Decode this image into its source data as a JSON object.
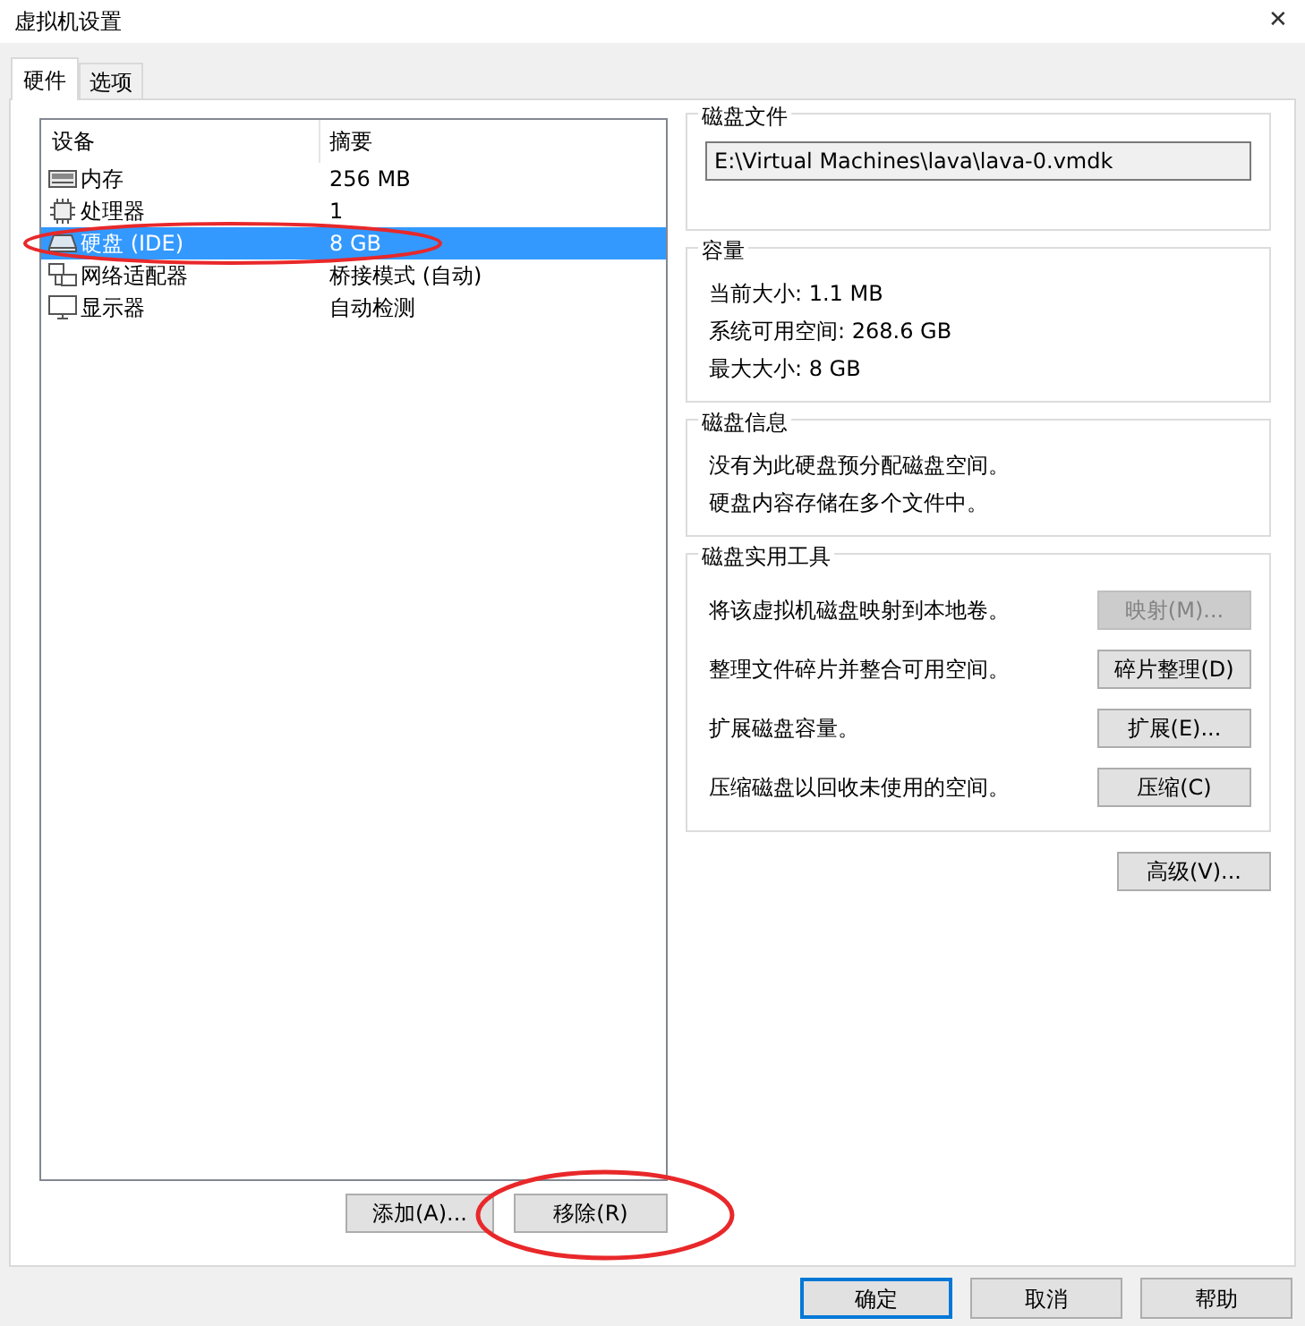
{
  "window": {
    "title": "虚拟机设置",
    "close": "✕"
  },
  "tabs": [
    {
      "label": "硬件",
      "selected": true
    },
    {
      "label": "选项",
      "selected": false
    }
  ],
  "devices": {
    "columns": [
      "设备",
      "摘要"
    ],
    "rows": [
      {
        "kind": "memory",
        "name": "内存",
        "summary": "256 MB",
        "selected": false
      },
      {
        "kind": "cpu",
        "name": "处理器",
        "summary": "1",
        "selected": false
      },
      {
        "kind": "disk",
        "name": "硬盘 (IDE)",
        "summary": "8 GB",
        "selected": true
      },
      {
        "kind": "network",
        "name": "网络适配器",
        "summary": "桥接模式 (自动)",
        "selected": false
      },
      {
        "kind": "display",
        "name": "显示器",
        "summary": "自动检测",
        "selected": false
      }
    ],
    "buttons": [
      {
        "label": "添加(A)..."
      },
      {
        "label": "移除(R)"
      }
    ]
  },
  "disk_file": {
    "title": "磁盘文件",
    "value": "E:\\Virtual Machines\\lava\\lava-0.vmdk"
  },
  "capacity": {
    "title": "容量",
    "lines": [
      "当前大小: 1.1 MB",
      "系统可用空间: 268.6 GB",
      "最大大小: 8 GB"
    ]
  },
  "disk_info": {
    "title": "磁盘信息",
    "lines": [
      "没有为此硬盘预分配磁盘空间。",
      "硬盘内容存储在多个文件中。"
    ]
  },
  "utilities": {
    "title": "磁盘实用工具",
    "rows": [
      {
        "text": "将该虚拟机磁盘映射到本地卷。",
        "button": "映射(M)...",
        "disabled": true
      },
      {
        "text": "整理文件碎片并整合可用空间。",
        "button": "碎片整理(D)",
        "disabled": false
      },
      {
        "text": "扩展磁盘容量。",
        "button": "扩展(E)...",
        "disabled": false
      },
      {
        "text": "压缩磁盘以回收未使用的空间。",
        "button": "压缩(C)",
        "disabled": false
      }
    ]
  },
  "advanced_button": "高级(V)...",
  "dialog_buttons": [
    {
      "label": "确定",
      "default": true
    },
    {
      "label": "取消",
      "default": false
    },
    {
      "label": "帮助",
      "default": false
    }
  ]
}
